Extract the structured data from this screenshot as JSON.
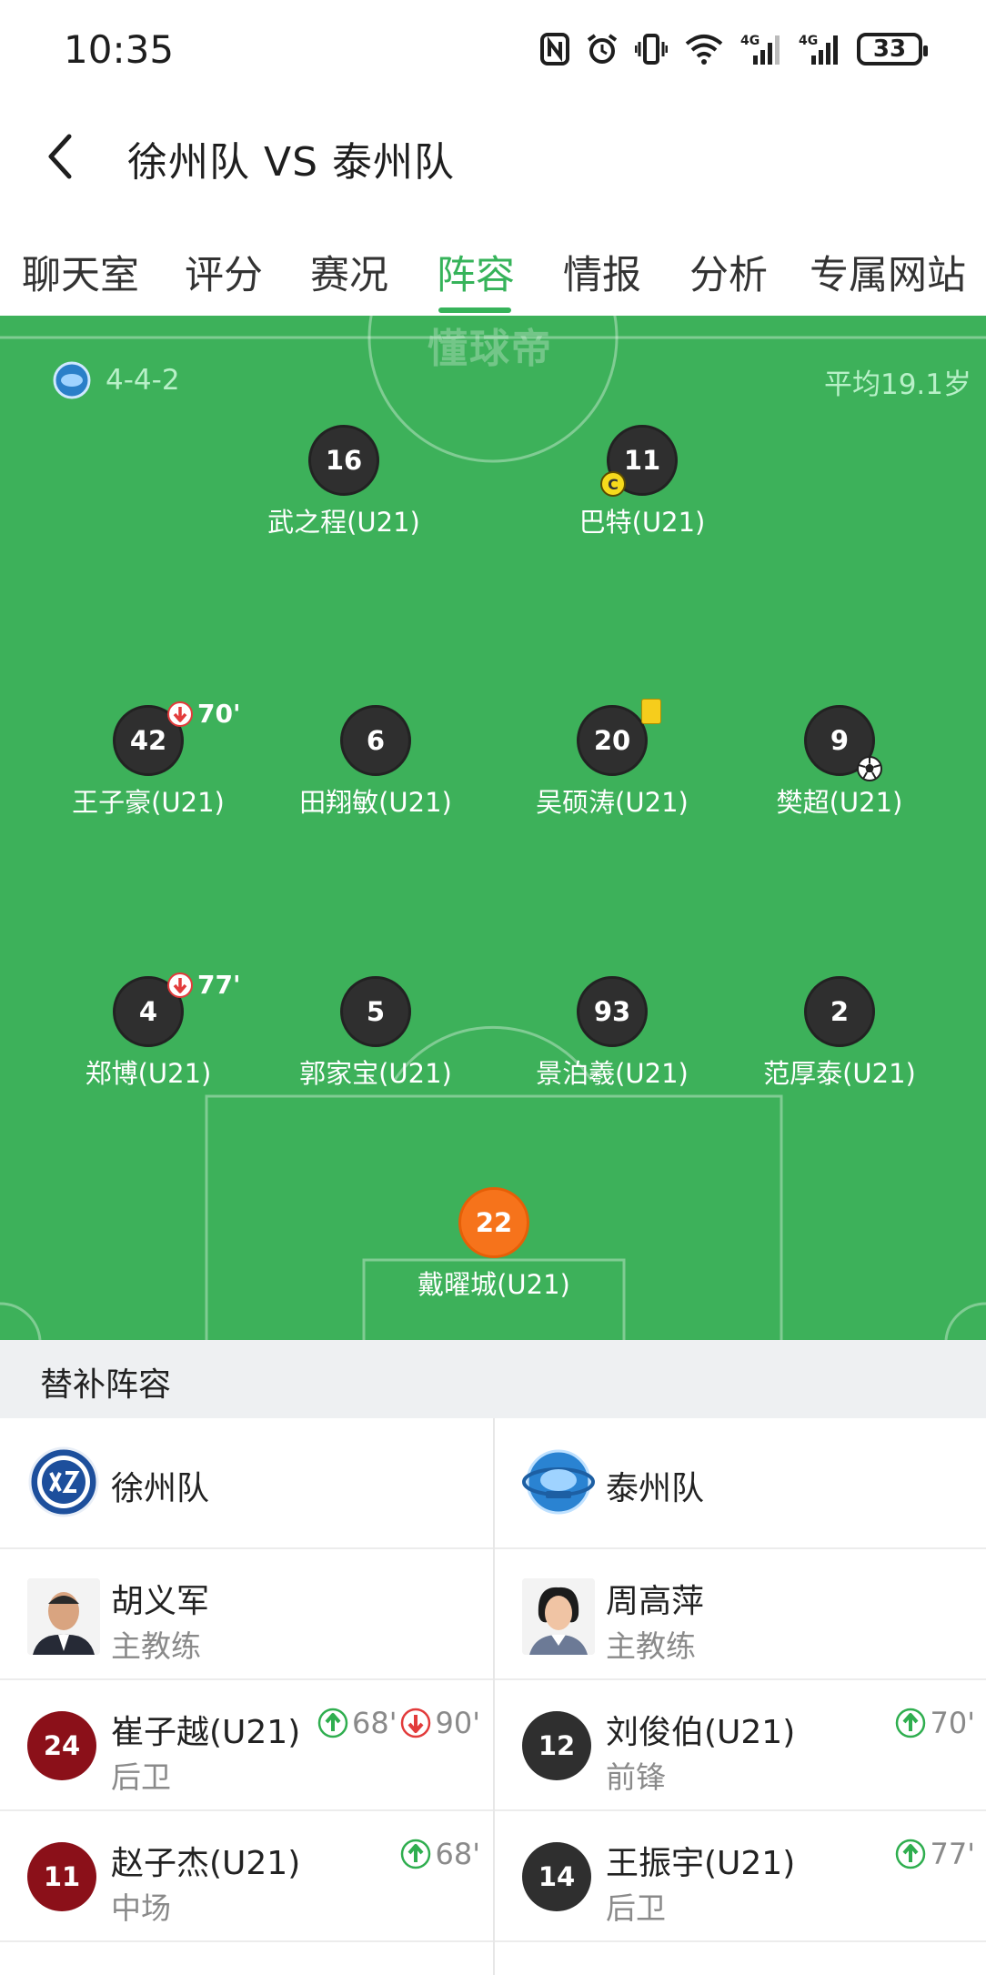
{
  "status_bar": {
    "time": "10:35",
    "battery": "33"
  },
  "header": {
    "title": "徐州队 VS 泰州队"
  },
  "tabs": [
    {
      "label": "聊天室"
    },
    {
      "label": "评分"
    },
    {
      "label": "赛况"
    },
    {
      "label": "阵容",
      "active": true
    },
    {
      "label": "情报"
    },
    {
      "label": "分析"
    },
    {
      "label": "专属网站"
    }
  ],
  "pitch": {
    "watermark": "懂球帝",
    "formation": "4-4-2",
    "average_age": "平均19.1岁",
    "colors": {
      "pitch": "#3db15a",
      "gk": "#f6731b",
      "outfield": "#2f2f2f",
      "accent": "#36b35a"
    },
    "players": [
      {
        "number": "16",
        "name": "武之程(U21)"
      },
      {
        "number": "11",
        "name": "巴特(U21)",
        "captain": "C"
      },
      {
        "number": "42",
        "name": "王子豪(U21)",
        "sub_out": "70'"
      },
      {
        "number": "6",
        "name": "田翔敏(U21)"
      },
      {
        "number": "20",
        "name": "吴硕涛(U21)",
        "yellow_card": true
      },
      {
        "number": "9",
        "name": "樊超(U21)",
        "goal": true
      },
      {
        "number": "4",
        "name": "郑博(U21)",
        "sub_out": "77'"
      },
      {
        "number": "5",
        "name": "郭家宝(U21)"
      },
      {
        "number": "93",
        "name": "景泊羲(U21)"
      },
      {
        "number": "2",
        "name": "范厚泰(U21)"
      },
      {
        "number": "22",
        "name": "戴曜城(U21)",
        "goalkeeper": true
      }
    ]
  },
  "subs": {
    "title": "替补阵容",
    "home": {
      "team": "徐州队",
      "coach": {
        "name": "胡义军",
        "role": "主教练"
      },
      "players": [
        {
          "number": "24",
          "name": "崔子越(U21)",
          "position": "后卫",
          "in": "68'",
          "out": "90'"
        },
        {
          "number": "11",
          "name": "赵子杰(U21)",
          "position": "中场",
          "in": "68'"
        }
      ]
    },
    "away": {
      "team": "泰州队",
      "coach": {
        "name": "周高萍",
        "role": "主教练"
      },
      "players": [
        {
          "number": "12",
          "name": "刘俊伯(U21)",
          "position": "前锋",
          "in": "70'"
        },
        {
          "number": "14",
          "name": "王振宇(U21)",
          "position": "后卫",
          "in": "77'"
        }
      ]
    }
  }
}
